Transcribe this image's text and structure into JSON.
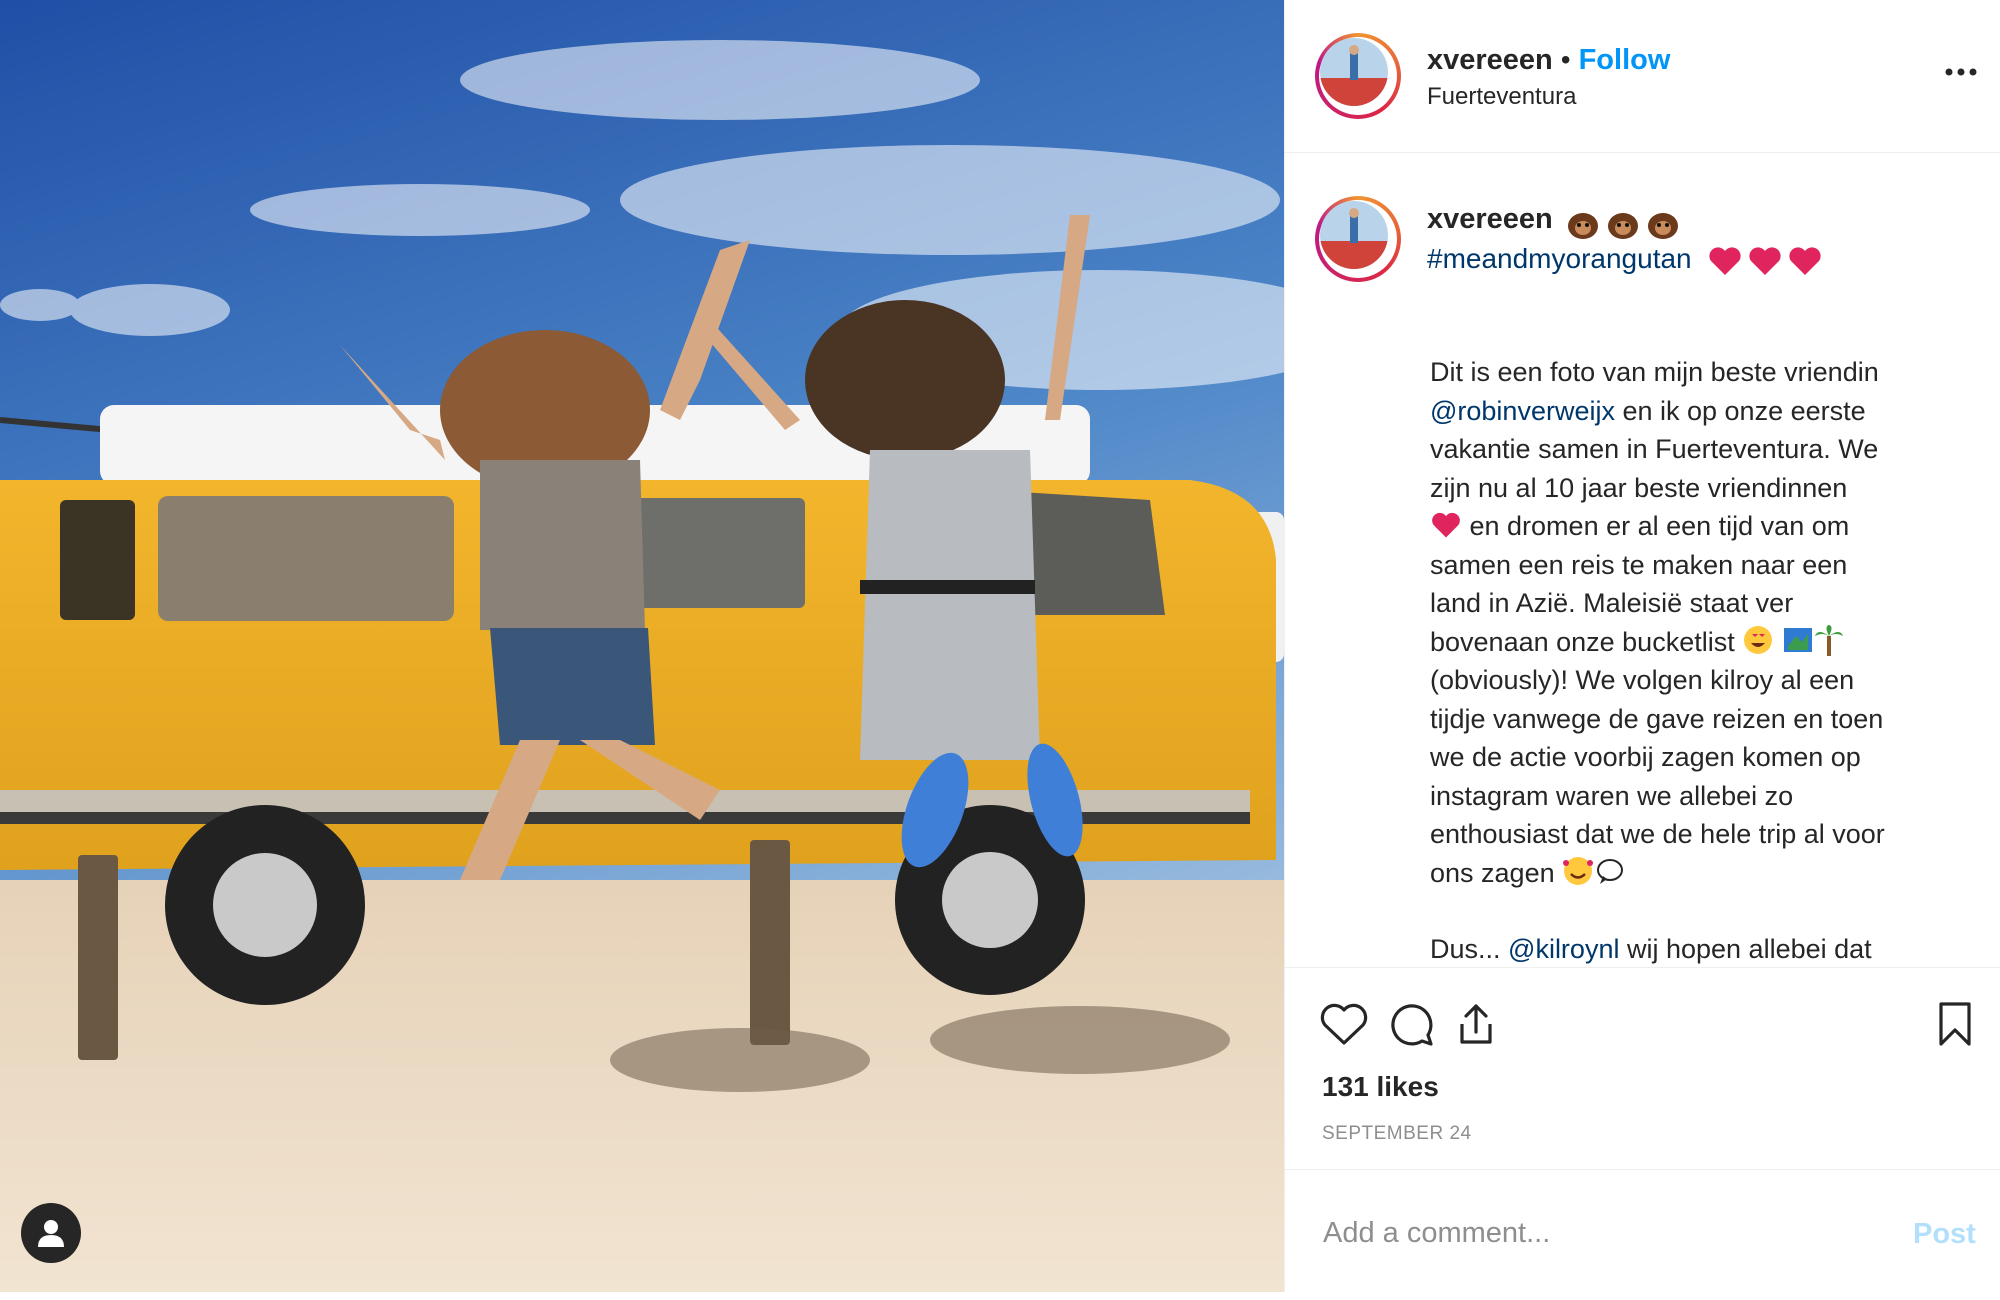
{
  "header": {
    "username": "xvereeen",
    "separator": "•",
    "follow_label": "Follow",
    "location": "Fuerteventura",
    "more_icon": "more-options-icon"
  },
  "caption": {
    "username": "xvereeen",
    "hashtag": "#meandmyorangutan",
    "lines": [
      "Dit is een foto van mijn beste vriendin",
      "@robinverweijx",
      " en ik op onze eerste",
      "vakantie samen in Fuerteventura. We",
      "zijn nu al 10 jaar beste vriendinnen",
      " en dromen er al een tijd van om",
      "samen een reis te maken naar een",
      "land in Azië. Maleisië staat ver",
      "bovenaan onze bucketlist ",
      "(obviously)! We volgen kilroy al een",
      "tijdje vanwege de gave reizen en toen",
      "we de actie voorbij zagen komen op",
      "instagram waren we allebei zo",
      "enthousiast dat we de hele trip al voor",
      "ons zagen ",
      "Dus... ",
      "@kilroynl",
      " wij hopen allebei dat"
    ]
  },
  "actions": {
    "like_icon": "heart-icon",
    "comment_icon": "comment-icon",
    "share_icon": "share-icon",
    "save_icon": "bookmark-icon",
    "likes": "131 likes",
    "date": "SEPTEMBER 24"
  },
  "comment_box": {
    "placeholder": "Add a comment...",
    "post_label": "Post"
  },
  "colors": {
    "accent": "#0095f6",
    "link": "#00376b",
    "post_disabled": "#b2dffc",
    "muted": "#8e8e8e",
    "heart": "#e0245e"
  }
}
